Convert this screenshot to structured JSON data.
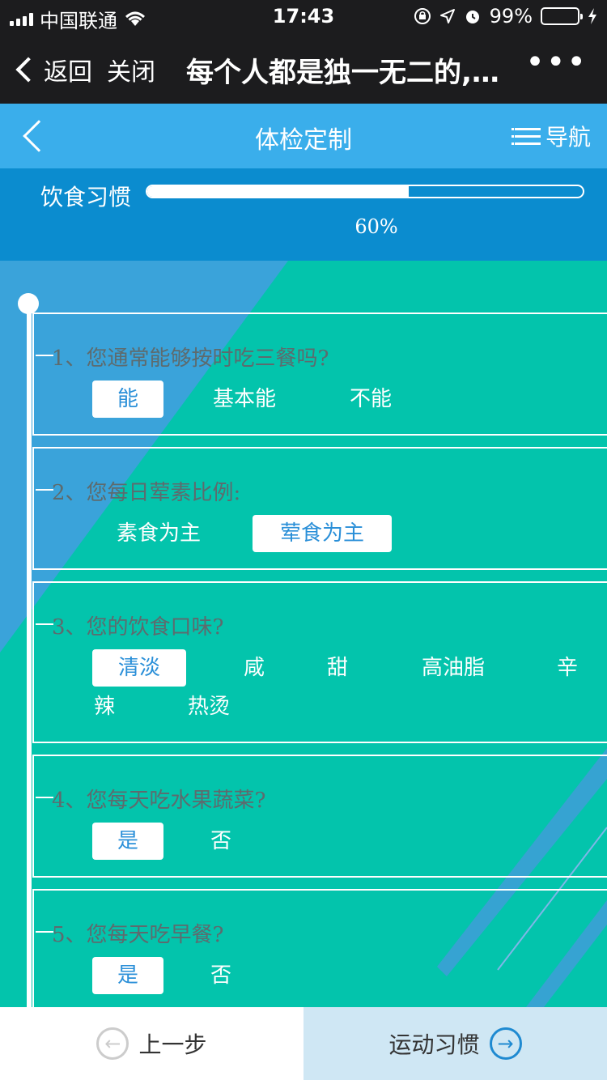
{
  "status_bar": {
    "carrier": "中国联通",
    "time": "17:43",
    "battery": "99%",
    "battery_level": 0.99
  },
  "wechat_bar": {
    "back_label": "返回",
    "close_label": "关闭",
    "title": "每个人都是独一无二的,…",
    "more_label": "•••"
  },
  "app_header": {
    "title": "体检定制",
    "nav_label": "导航"
  },
  "progress": {
    "label": "饮食习惯",
    "percent_text": "60%",
    "value": 0.6
  },
  "questions": [
    {
      "text": "1、您通常能够按时吃三餐吗?",
      "options": [
        {
          "label": "能",
          "selected": true
        },
        {
          "label": "基本能",
          "selected": false
        },
        {
          "label": "不能",
          "selected": false
        }
      ]
    },
    {
      "text": "2、您每日荤素比例:",
      "options": [
        {
          "label": "素食为主",
          "selected": false
        },
        {
          "label": "荤食为主",
          "selected": true
        }
      ]
    },
    {
      "text": "3、您的饮食口味?",
      "options": [
        {
          "label": "清淡",
          "selected": true
        },
        {
          "label": "咸",
          "selected": false
        },
        {
          "label": "甜",
          "selected": false
        },
        {
          "label": "高油脂",
          "selected": false
        },
        {
          "label": "辛辣",
          "selected": false
        },
        {
          "label": "热烫",
          "selected": false
        }
      ]
    },
    {
      "text": "4、您每天吃水果蔬菜?",
      "options": [
        {
          "label": "是",
          "selected": true
        },
        {
          "label": "否",
          "selected": false
        }
      ]
    },
    {
      "text": "5、您每天吃早餐?",
      "options": [
        {
          "label": "是",
          "selected": true
        },
        {
          "label": "否",
          "selected": false
        }
      ]
    }
  ],
  "footer": {
    "prev_label": "上一步",
    "next_label": "运动习惯"
  },
  "colors": {
    "content_bg": "#03c4ac",
    "header_bg": "#3aaeeb",
    "progress_bg": "#0b8ccf",
    "selected_text": "#2a8fd8"
  }
}
